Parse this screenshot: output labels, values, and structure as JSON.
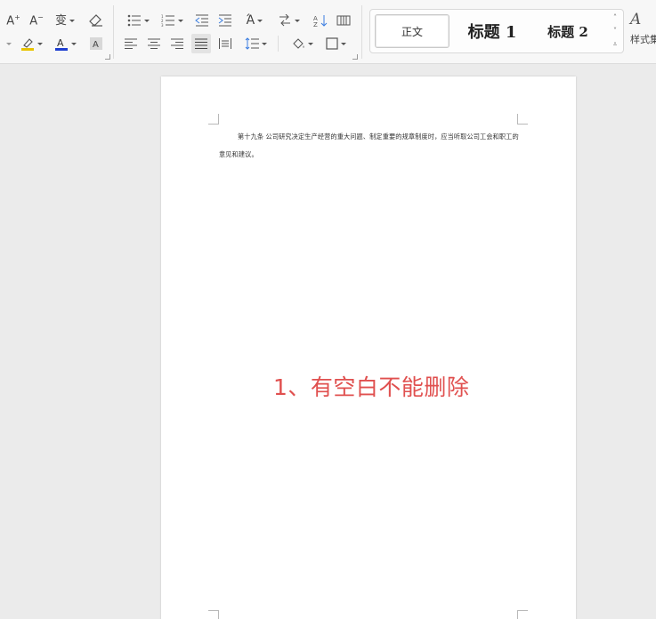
{
  "ribbon": {
    "styles": {
      "zhengwen": "正文",
      "heading1": "标题 1",
      "heading2": "标题 2"
    },
    "style_set_label": "样式集",
    "icons": {
      "font_color": "#1f3fd0",
      "highlight_color": "#e8c400"
    }
  },
  "document": {
    "paragraph": "第十九条 公司研究决定生产经营的重大问题、制定重要的规章制度时，应当听取公司工会和职工的意见和建议。",
    "annotation": "1、有空白不能删除",
    "annotation_color": "#e0504f"
  }
}
